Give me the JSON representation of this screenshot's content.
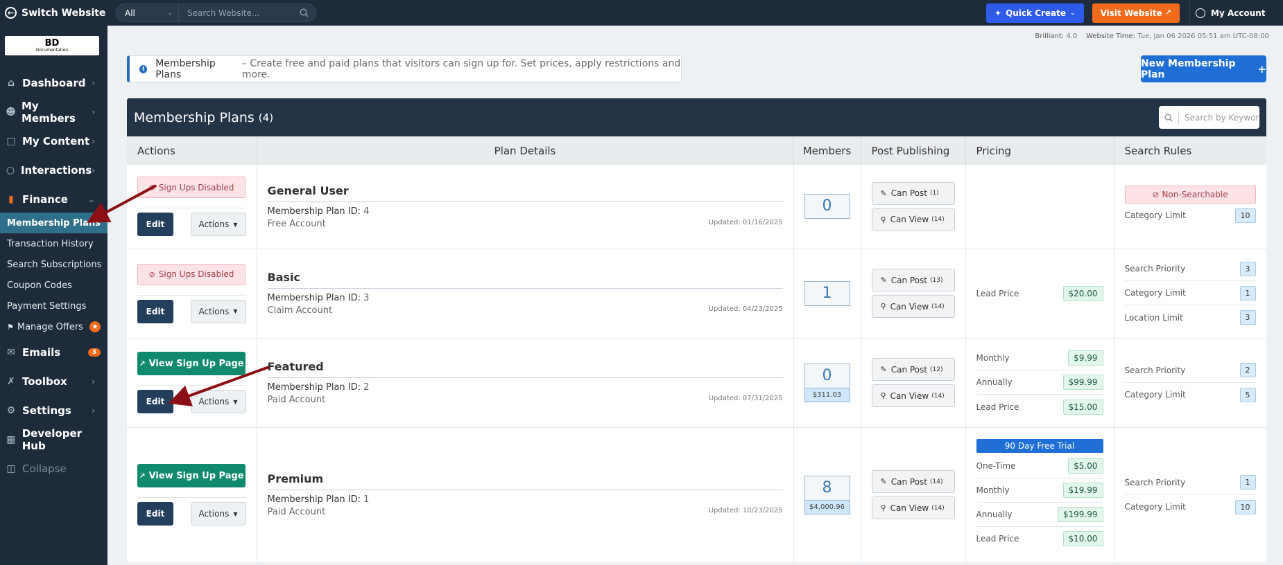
{
  "topbar": {
    "switch_label": "Switch Website",
    "search_scope": "All",
    "search_placeholder": "Search Website...",
    "quick_create": "Quick Create",
    "visit_website": "Visit Website",
    "my_account": "My Account"
  },
  "sidebar": {
    "logo_main": "BD",
    "logo_sub": "Documentation",
    "items": [
      {
        "label": "Dashboard"
      },
      {
        "label": "My Members"
      },
      {
        "label": "My Content"
      },
      {
        "label": "Interactions"
      },
      {
        "label": "Finance"
      }
    ],
    "finance_sub": [
      {
        "label": "Membership Plans"
      },
      {
        "label": "Transaction History"
      },
      {
        "label": "Search Subscriptions"
      },
      {
        "label": "Coupon Codes"
      },
      {
        "label": "Payment Settings"
      },
      {
        "label": "Manage Offers"
      }
    ],
    "emails": {
      "label": "Emails",
      "badge": "3"
    },
    "toolbox": "Toolbox",
    "settings": "Settings",
    "developer_hub": "Developer Hub",
    "collapse": "Collapse"
  },
  "meta": {
    "brilliant_label": "Brilliant:",
    "brilliant_value": "4.0",
    "time_label": "Website Time:",
    "time_value": "Tue, Jan 06 2026 05:51 am UTC-08:00"
  },
  "alert": {
    "title": "Membership Plans",
    "text": "– Create free and paid plans that visitors can sign up for. Set prices, apply restrictions and more."
  },
  "new_plan_button": "New Membership Plan",
  "card": {
    "title": "Membership Plans",
    "count": "(4)",
    "search_placeholder": "Search by Keywor"
  },
  "columns": [
    "Actions",
    "Plan Details",
    "Members",
    "Post Publishing",
    "Pricing",
    "Search Rules"
  ],
  "labels": {
    "signups_disabled": "Sign Ups Disabled",
    "view_signup": "View Sign Up Page",
    "edit": "Edit",
    "actions": "Actions",
    "plan_id": "Membership Plan ID:",
    "can_post": "Can Post",
    "can_view": "Can View",
    "non_searchable": "Non-Searchable"
  },
  "plans": [
    {
      "name": "General User",
      "id": "4",
      "type": "Free Account",
      "updated": "Updated: 01/16/2025",
      "members": "0",
      "revenue": "",
      "can_post": "(1)",
      "can_view": "(14)",
      "pricing": [],
      "search": [
        {
          "label": "Category Limit",
          "value": "10"
        }
      ]
    },
    {
      "name": "Basic",
      "id": "3",
      "type": "Claim Account",
      "updated": "Updated: 04/23/2025",
      "members": "1",
      "revenue": "",
      "can_post": "(13)",
      "can_view": "(14)",
      "pricing": [
        {
          "label": "Lead Price",
          "value": "$20.00"
        }
      ],
      "search": [
        {
          "label": "Search Priority",
          "value": "3"
        },
        {
          "label": "Category Limit",
          "value": "1"
        },
        {
          "label": "Location Limit",
          "value": "3"
        }
      ]
    },
    {
      "name": "Featured",
      "id": "2",
      "type": "Paid Account",
      "updated": "Updated: 07/31/2025",
      "members": "0",
      "revenue": "$311.03",
      "can_post": "(12)",
      "can_view": "(14)",
      "pricing": [
        {
          "label": "Monthly",
          "value": "$9.99"
        },
        {
          "label": "Annually",
          "value": "$99.99"
        },
        {
          "label": "Lead Price",
          "value": "$15.00"
        }
      ],
      "search": [
        {
          "label": "Search Priority",
          "value": "2"
        },
        {
          "label": "Category Limit",
          "value": "5"
        }
      ]
    },
    {
      "name": "Premium",
      "id": "1",
      "type": "Paid Account",
      "updated": "Updated: 10/23/2025",
      "members": "8",
      "revenue": "$4,000.96",
      "can_post": "(14)",
      "can_view": "(14)",
      "trial": "90 Day Free Trial",
      "pricing": [
        {
          "label": "One-Time",
          "value": "$5.00"
        },
        {
          "label": "Monthly",
          "value": "$19.99"
        },
        {
          "label": "Annually",
          "value": "$199.99"
        },
        {
          "label": "Lead Price",
          "value": "$10.00"
        }
      ],
      "search": [
        {
          "label": "Search Priority",
          "value": "1"
        },
        {
          "label": "Category Limit",
          "value": "10"
        }
      ]
    }
  ],
  "colors": {
    "accent": "#1f6fd6",
    "sidebar": "#1d2b3a",
    "active_sub": "#2f6f89",
    "orange": "#f26b1d",
    "arrow": "#8b0f14"
  }
}
